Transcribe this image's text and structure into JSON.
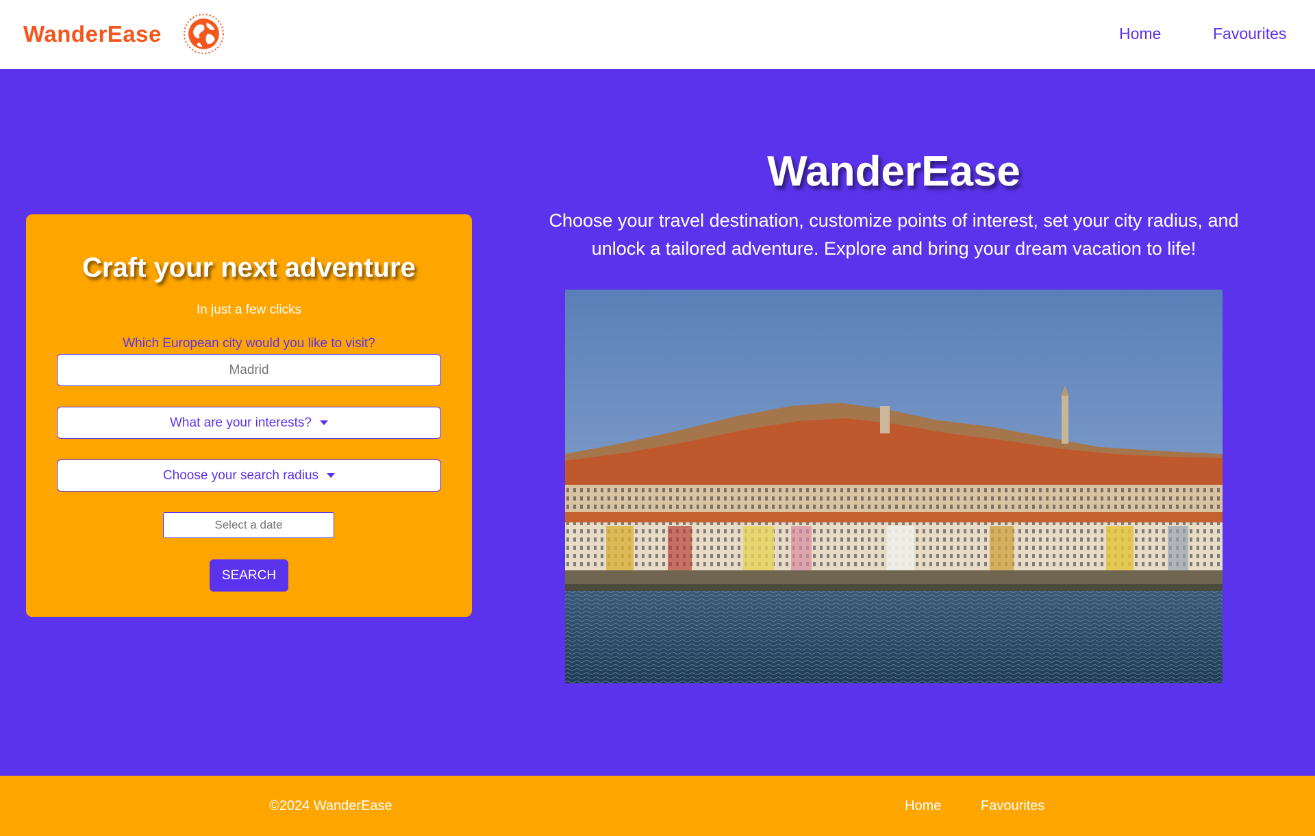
{
  "header": {
    "brand": "WanderEase",
    "logo_icon": "globe-icon",
    "nav": {
      "home": "Home",
      "favourites": "Favourites"
    }
  },
  "form": {
    "title": "Craft your next adventure",
    "subtitle": "In just a few clicks",
    "city_question": "Which European city would you like to visit?",
    "city_placeholder": "Madrid",
    "interests_label": "What are your interests?",
    "radius_label": "Choose your search radius",
    "date_placeholder": "Select a date",
    "search_button": "SEARCH"
  },
  "hero": {
    "title": "WanderEase",
    "description": "Choose your travel destination, customize points of interest, set your city radius, and unlock a tailored adventure. Explore and bring your dream vacation to life!",
    "image_icon": "city-riverside-image"
  },
  "footer": {
    "copyright": "©2024 WanderEase",
    "nav": {
      "home": "Home",
      "favourites": "Favourites"
    }
  },
  "colors": {
    "primary": "#5b33ec",
    "accent": "#ffa500",
    "brand": "#f4561c",
    "header_bg": "#ffffff"
  }
}
